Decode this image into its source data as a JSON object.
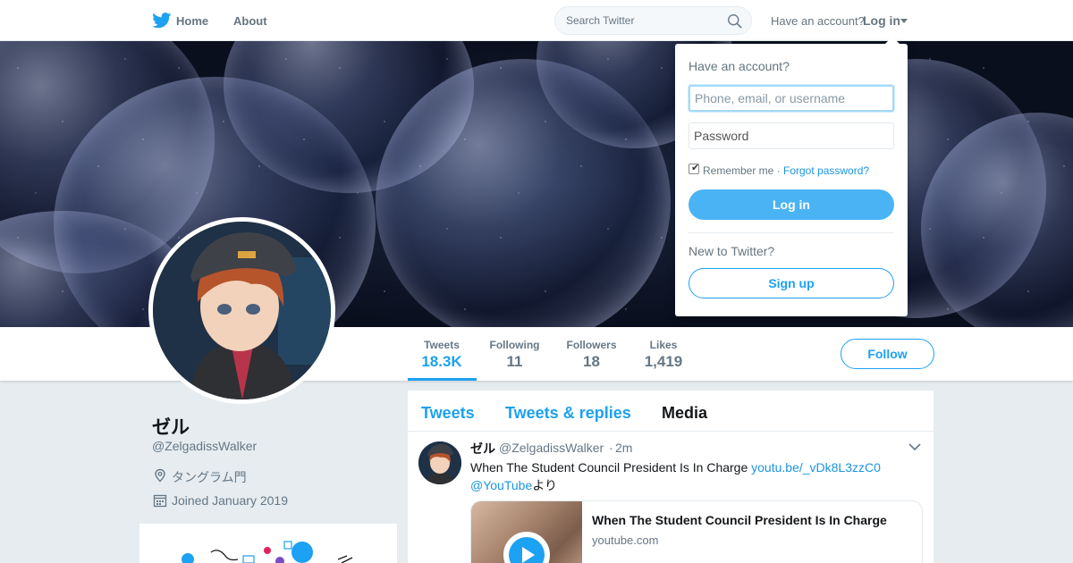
{
  "nav": {
    "home": "Home",
    "about": "About",
    "search_placeholder": "Search Twitter",
    "have_account": "Have an account?",
    "login": "Log in"
  },
  "profile": {
    "name": "ゼル",
    "handle": "@ZelgadissWalker",
    "location": "タングラム門",
    "joined": "Joined January 2019",
    "follow": "Follow",
    "stats": [
      {
        "label": "Tweets",
        "value": "18.3K"
      },
      {
        "label": "Following",
        "value": "11"
      },
      {
        "label": "Followers",
        "value": "18"
      },
      {
        "label": "Likes",
        "value": "1,419"
      }
    ]
  },
  "timeline": {
    "tabs": [
      "Tweets",
      "Tweets & replies",
      "Media"
    ],
    "tweet": {
      "name": "ゼル",
      "handle": "@ZelgadissWalker",
      "dot": "·",
      "time": "2m",
      "text": "When The Student Council President Is In Charge ",
      "link": "youtu.be/_vDk8L3zzC0",
      "mention": "@YouTube",
      "suffix": "より",
      "card_title": "When The Student Council President Is In Charge",
      "card_domain": "youtube.com"
    }
  },
  "login_dropdown": {
    "title": "Have an account?",
    "user_placeholder": "Phone, email, or username",
    "password_placeholder": "Password",
    "remember": "Remember me",
    "separator": "·",
    "forgot": "Forgot password?",
    "login": "Log in",
    "new": "New to Twitter?",
    "signup": "Sign up"
  },
  "colors": {
    "brand": "#1da1f2",
    "background": "#e6ecf0",
    "muted_text": "#657786"
  }
}
